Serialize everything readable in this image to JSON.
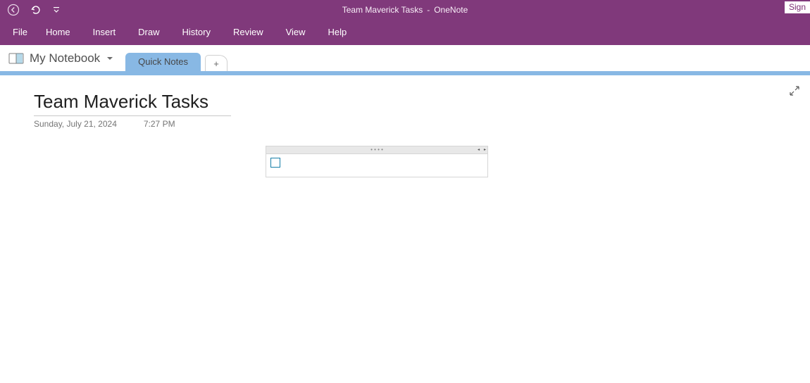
{
  "titlebar": {
    "doc_title": "Team Maverick Tasks",
    "separator": "  -  ",
    "app_name": "OneNote",
    "sign_label": "Sign"
  },
  "menu": {
    "file": "File",
    "items": [
      "Home",
      "Insert",
      "Draw",
      "History",
      "Review",
      "View",
      "Help"
    ]
  },
  "notebook": {
    "name": "My Notebook"
  },
  "section_tab": {
    "label": "Quick Notes"
  },
  "add_tab_label": "+",
  "page": {
    "title": "Team Maverick Tasks",
    "date": "Sunday, July 21, 2024",
    "time": "7:27 PM"
  }
}
